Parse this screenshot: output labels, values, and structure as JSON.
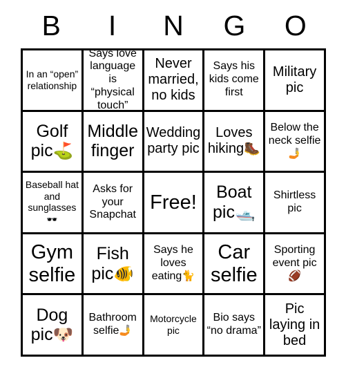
{
  "card": {
    "header_letters": [
      "B",
      "I",
      "N",
      "G",
      "O"
    ],
    "free_space_label": "Free!",
    "rows": [
      [
        {
          "text": "In an “open” relationship",
          "size": "fs-xs",
          "emoji": ""
        },
        {
          "text": "Says love language is “physical touch”",
          "size": "fs-sm",
          "emoji": ""
        },
        {
          "text": "Never married, no kids",
          "size": "fs-md",
          "emoji": ""
        },
        {
          "text": "Says his kids come first",
          "size": "fs-sm",
          "emoji": ""
        },
        {
          "text": "Military pic",
          "size": "fs-md",
          "emoji": ""
        }
      ],
      [
        {
          "text": "Golf pic",
          "size": "fs-lg",
          "emoji": "⛳"
        },
        {
          "text": "Middle finger",
          "size": "fs-lg",
          "emoji": ""
        },
        {
          "text": "Wedding party pic",
          "size": "fs-md",
          "emoji": ""
        },
        {
          "text": "Loves hiking",
          "size": "fs-md",
          "emoji": "🥾"
        },
        {
          "text": "Below the neck selfie",
          "size": "fs-sm",
          "emoji": "🤳"
        }
      ],
      [
        {
          "text": "Baseball hat and sunglasses",
          "size": "fs-xs",
          "emoji": "🕶️"
        },
        {
          "text": "Asks for your Snapchat",
          "size": "fs-sm",
          "emoji": ""
        },
        {
          "text": "Free!",
          "size": "fs-xl",
          "emoji": ""
        },
        {
          "text": "Boat pic",
          "size": "fs-lg",
          "emoji": "🛥️"
        },
        {
          "text": "Shirtless pic",
          "size": "fs-sm",
          "emoji": ""
        }
      ],
      [
        {
          "text": "Gym selfie",
          "size": "fs-xl",
          "emoji": ""
        },
        {
          "text": "Fish pic",
          "size": "fs-lg",
          "emoji": "🐠"
        },
        {
          "text": "Says he loves eating",
          "size": "fs-sm",
          "emoji": "🐈"
        },
        {
          "text": "Car selfie",
          "size": "fs-xl",
          "emoji": ""
        },
        {
          "text": "Sporting event pic",
          "size": "fs-sm",
          "emoji": "🏈"
        }
      ],
      [
        {
          "text": "Dog pic",
          "size": "fs-lg",
          "emoji": "🐶"
        },
        {
          "text": "Bathroom selfie",
          "size": "fs-sm",
          "emoji": "🤳"
        },
        {
          "text": "Motorcycle pic",
          "size": "fs-xs",
          "emoji": ""
        },
        {
          "text": "Bio says “no drama”",
          "size": "fs-sm",
          "emoji": ""
        },
        {
          "text": "Pic laying in bed",
          "size": "fs-md",
          "emoji": ""
        }
      ]
    ]
  },
  "colors": {
    "border": "#000000",
    "background": "#ffffff",
    "text": "#000000"
  }
}
